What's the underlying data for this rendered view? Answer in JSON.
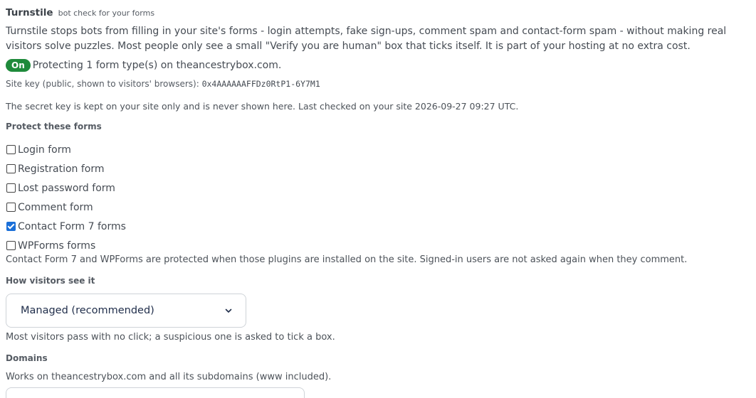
{
  "header": {
    "title": "Turnstile",
    "subtitle": "bot check for your forms"
  },
  "intro": "Turnstile stops bots from filling in your site's forms - login attempts, fake sign-ups, comment spam and contact-form spam - without making real visitors solve puzzles. Most people only see a small \"Verify you are human\" box that ticks itself. It is part of your hosting at no extra cost.",
  "status": {
    "badge": "On",
    "text": "Protecting 1 form type(s) on theancestrybox.com."
  },
  "site_key": {
    "label": "Site key (public, shown to visitors' browsers):",
    "value": "0x4AAAAAAFFDz0RtP1-6Y7M1"
  },
  "secret_note": "The secret key is kept on your site only and is never shown here. Last checked on your site 2026-09-27 09:27 UTC.",
  "protect": {
    "label": "Protect these forms",
    "options": [
      {
        "label": "Login form",
        "checked": false
      },
      {
        "label": "Registration form",
        "checked": false
      },
      {
        "label": "Lost password form",
        "checked": false
      },
      {
        "label": "Comment form",
        "checked": false
      },
      {
        "label": "Contact Form 7 forms",
        "checked": true
      },
      {
        "label": "WPForms forms",
        "checked": false
      }
    ],
    "note": "Contact Form 7 and WPForms are protected when those plugins are installed on the site. Signed-in users are not asked again when they comment."
  },
  "visibility": {
    "label": "How visitors see it",
    "selected": "Managed (recommended)",
    "note": "Most visitors pass with no click; a suspicious one is asked to tick a box."
  },
  "domains": {
    "label": "Domains",
    "note": "Works on theancestrybox.com and all its subdomains (www included)."
  },
  "colors": {
    "badge_bg": "#1f8a3b",
    "checkbox_accent": "#1a6fd8"
  },
  "icons": {
    "dropdown": "chevron-down-icon",
    "checkbox_checked": "check-icon"
  }
}
